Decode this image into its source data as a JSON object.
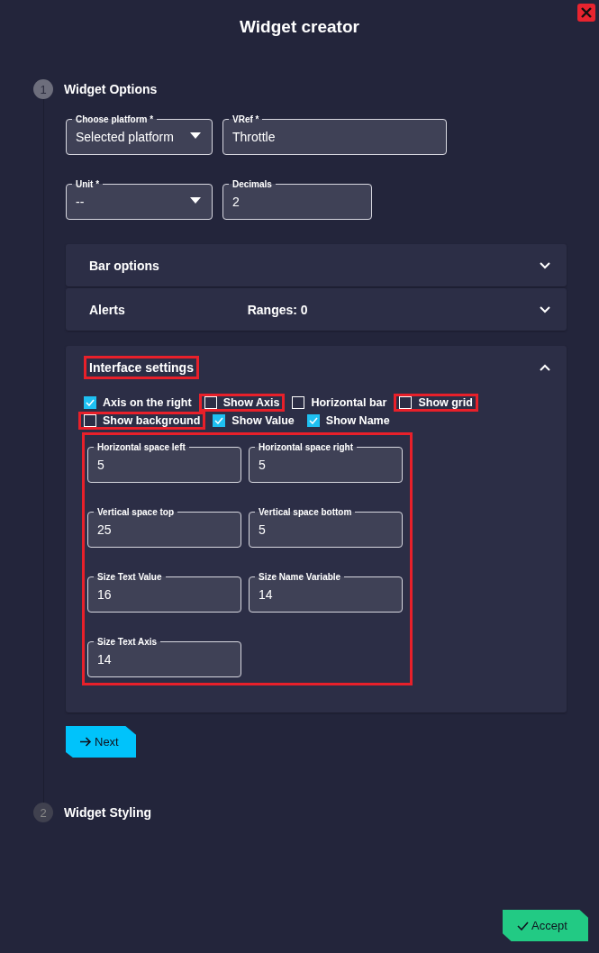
{
  "dialog": {
    "title": "Widget creator"
  },
  "steps": [
    {
      "number": "1",
      "title": "Widget Options",
      "active": true
    },
    {
      "number": "2",
      "title": "Widget Styling",
      "active": false
    }
  ],
  "fields": [
    {
      "kind": "select",
      "label": "Choose platform *",
      "value": "Selected platform"
    },
    {
      "kind": "text",
      "label": "VRef *",
      "value": "Throttle"
    },
    {
      "kind": "select",
      "label": "Unit *",
      "value": "--"
    },
    {
      "kind": "text",
      "label": "Decimals",
      "value": "2"
    }
  ],
  "panels": [
    {
      "title": "Bar options",
      "expanded": false,
      "highlighted": false
    },
    {
      "title": "Alerts",
      "summary": "Ranges: 0",
      "expanded": false,
      "highlighted": false
    },
    {
      "title": "Interface settings",
      "expanded": true,
      "highlighted": true
    }
  ],
  "interface_settings": {
    "checkboxes": [
      {
        "label": "Axis on the right",
        "checked": true,
        "highlighted": false
      },
      {
        "label": "Show Axis",
        "checked": false,
        "highlighted": true
      },
      {
        "label": "Horizontal bar",
        "checked": false,
        "highlighted": false
      },
      {
        "label": "Show grid",
        "checked": false,
        "highlighted": true
      },
      {
        "label": "Show background",
        "checked": false,
        "highlighted": true
      },
      {
        "label": "Show Value",
        "checked": true,
        "highlighted": false
      },
      {
        "label": "Show Name",
        "checked": true,
        "highlighted": false
      }
    ],
    "fields_highlighted": true,
    "fields": [
      {
        "label": "Horizontal space left",
        "value": "5"
      },
      {
        "label": "Horizontal space right",
        "value": "5"
      },
      {
        "label": "Vertical space top",
        "value": "25"
      },
      {
        "label": "Vertical space bottom",
        "value": "5"
      },
      {
        "label": "Size Text Value",
        "value": "16"
      },
      {
        "label": "Size Name Variable",
        "value": "14"
      },
      {
        "label": "Size Text Axis",
        "value": "14"
      }
    ]
  },
  "buttons": [
    {
      "kind": "next",
      "label": "Next"
    },
    {
      "kind": "accept",
      "label": "Accept"
    }
  ]
}
